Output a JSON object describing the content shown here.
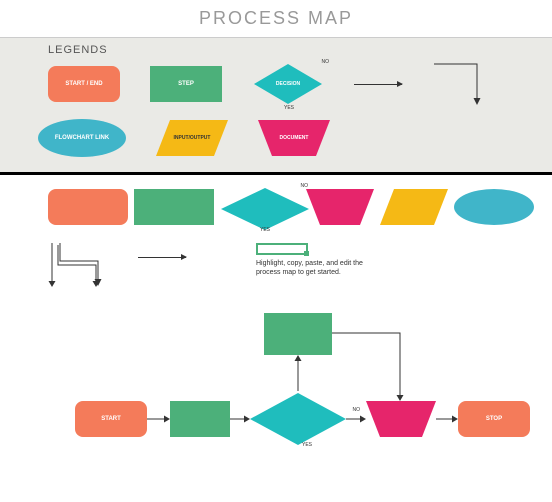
{
  "title": "PROCESS MAP",
  "legendsHeader": "LEGENDS",
  "legend": {
    "startEnd": "START / END",
    "step": "STEP",
    "decision": "DECISION",
    "decisionNo": "NO",
    "decisionYes": "YES",
    "flowchartLink": "FLOWCHART LINK",
    "inputOutput": "INPUT/OUTPUT",
    "document": "DOCUMENT"
  },
  "midDecisionNo": "NO",
  "midDecisionYes": "YES",
  "instruction": "Highlight, copy, paste, and edit the process map to get started.",
  "flow": {
    "start": "START",
    "stop": "STOP",
    "decisionNo": "NO",
    "decisionYes": "YES"
  },
  "colors": {
    "orange": "#f47b5a",
    "green": "#4cb07a",
    "teal": "#1fbdbd",
    "yellow": "#f5b915",
    "pink": "#e6256b",
    "blue": "#40b5c9"
  },
  "chart_data": {
    "type": "table",
    "title": "Process Map Template",
    "legend_shapes": [
      {
        "shape": "rounded-rect",
        "color": "orange",
        "meaning": "START / END"
      },
      {
        "shape": "rect",
        "color": "green",
        "meaning": "STEP"
      },
      {
        "shape": "diamond",
        "color": "teal",
        "meaning": "DECISION",
        "outputs": [
          "NO",
          "YES"
        ]
      },
      {
        "shape": "arrow",
        "color": "black",
        "meaning": "flow-connector"
      },
      {
        "shape": "bent-arrow",
        "color": "black",
        "meaning": "flow-connector-bent"
      },
      {
        "shape": "ellipse",
        "color": "blue",
        "meaning": "FLOWCHART LINK"
      },
      {
        "shape": "parallelogram",
        "color": "yellow",
        "meaning": "INPUT/OUTPUT"
      },
      {
        "shape": "trapezoid-down",
        "color": "pink",
        "meaning": "DOCUMENT"
      }
    ],
    "example_flow": {
      "nodes": [
        {
          "id": "n1",
          "type": "start",
          "label": "START"
        },
        {
          "id": "n2",
          "type": "step",
          "label": ""
        },
        {
          "id": "n3",
          "type": "decision",
          "label": "",
          "outputs": {
            "NO": "n4",
            "YES": "n5"
          }
        },
        {
          "id": "n4",
          "type": "step",
          "label": ""
        },
        {
          "id": "n5",
          "type": "document",
          "label": ""
        },
        {
          "id": "n6",
          "type": "end",
          "label": "STOP"
        }
      ],
      "edges": [
        {
          "from": "n1",
          "to": "n2"
        },
        {
          "from": "n2",
          "to": "n3"
        },
        {
          "from": "n3",
          "to": "n5",
          "label": "NO"
        },
        {
          "from": "n3",
          "to": "n4",
          "label": "YES (up)"
        },
        {
          "from": "n4",
          "to": "n5"
        },
        {
          "from": "n5",
          "to": "n6"
        }
      ]
    }
  }
}
